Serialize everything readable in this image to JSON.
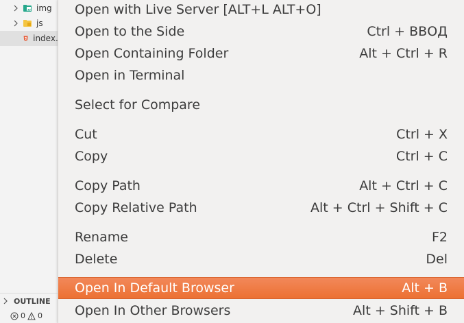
{
  "explorer": {
    "items": [
      {
        "label": "img",
        "type": "folder",
        "icon": "image-folder-icon"
      },
      {
        "label": "js",
        "type": "folder",
        "icon": "js-folder-icon"
      },
      {
        "label": "index.html",
        "type": "file",
        "icon": "html5-icon"
      }
    ],
    "outline_label": "OUTLINE",
    "status": {
      "errors": "0",
      "warnings": "0"
    }
  },
  "menu": {
    "items": [
      {
        "label": "Open with Live Server [ALT+L ALT+O]",
        "shortcut": ""
      },
      {
        "label": "Open to the Side",
        "shortcut": "Ctrl + ВВОД"
      },
      {
        "label": "Open Containing Folder",
        "shortcut": "Alt + Ctrl + R"
      },
      {
        "label": "Open in Terminal",
        "shortcut": ""
      },
      {
        "label": "Select for Compare",
        "shortcut": ""
      },
      {
        "label": "Cut",
        "shortcut": "Ctrl + X"
      },
      {
        "label": "Copy",
        "shortcut": "Ctrl + C"
      },
      {
        "label": "Copy Path",
        "shortcut": "Alt + Ctrl + C"
      },
      {
        "label": "Copy Relative Path",
        "shortcut": "Alt + Ctrl + Shift + C"
      },
      {
        "label": "Rename",
        "shortcut": "F2"
      },
      {
        "label": "Delete",
        "shortcut": "Del"
      },
      {
        "label": "Open In Default Browser",
        "shortcut": "Alt + B"
      },
      {
        "label": "Open In Other Browsers",
        "shortcut": "Alt + Shift + B"
      }
    ],
    "highlighted_item": "Open In Default Browser",
    "highlight_color": "#ef7b45"
  }
}
